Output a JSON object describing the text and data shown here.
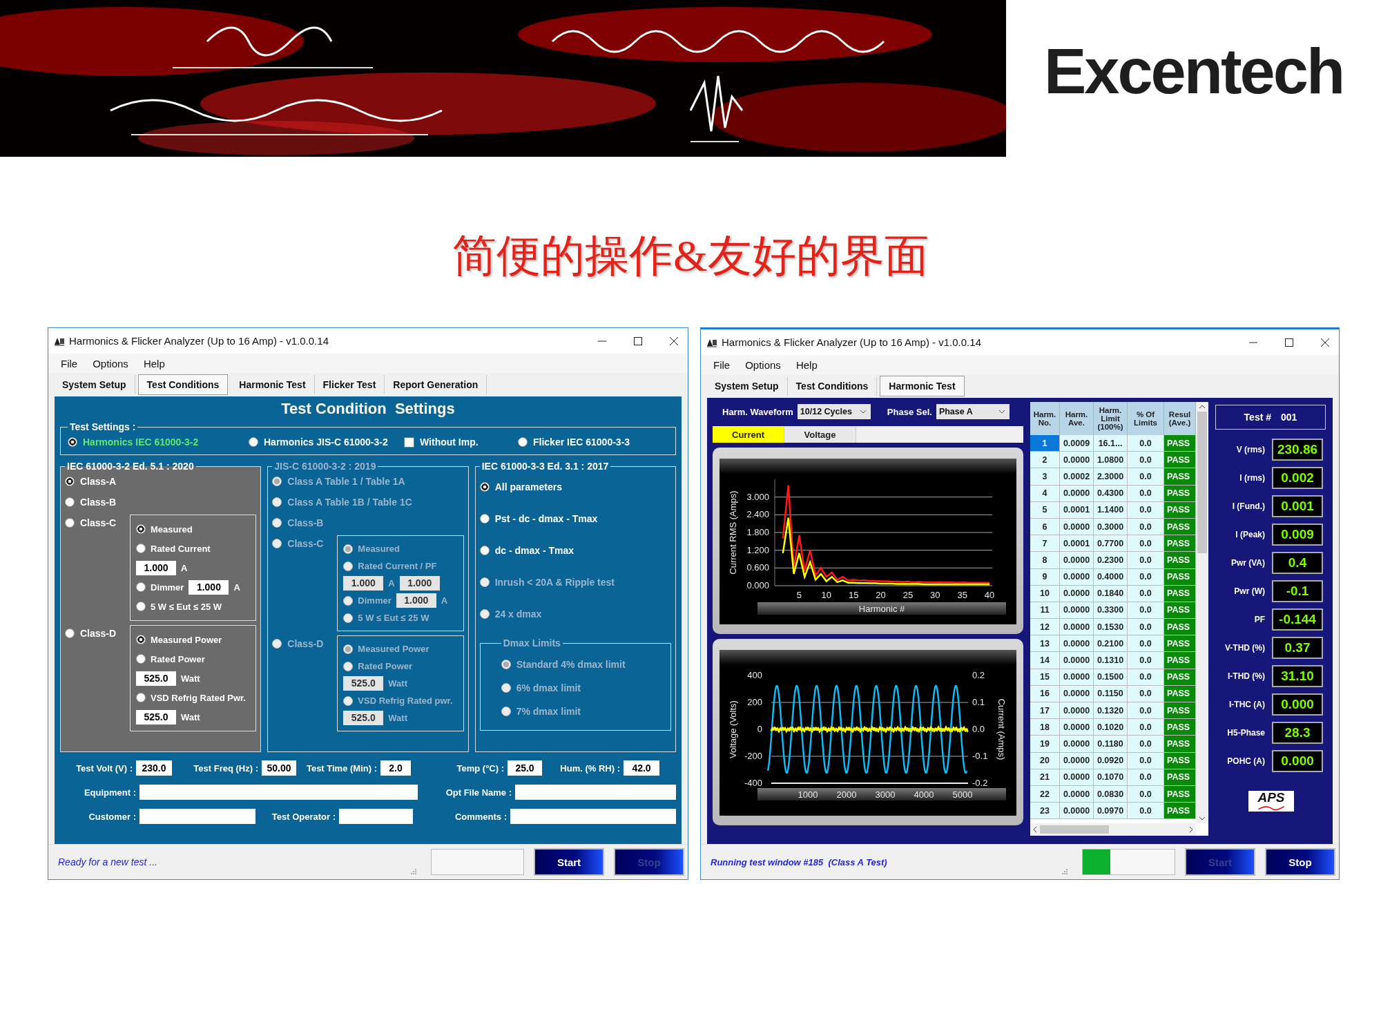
{
  "logo": {
    "text": "Excentech"
  },
  "title": "简便的操作&友好的界面",
  "windows": [
    {
      "kind": "conditions",
      "title": "Harmonics & Flicker Analyzer (Up to 16 Amp) - v1.0.0.14",
      "menu": [
        "File",
        "Options",
        "Help"
      ],
      "tabs": [
        {
          "label": "System Setup",
          "selected": false
        },
        {
          "label": "Test Conditions",
          "selected": true
        },
        {
          "label": "Harmonic Test",
          "selected": false
        },
        {
          "label": "Flicker Test",
          "selected": false
        },
        {
          "label": "Report Generation",
          "selected": false
        }
      ],
      "heading": "Test Condition  Settings",
      "test_settings": {
        "legend": "Test Settings :",
        "options": [
          {
            "kind": "radio",
            "label": "Harmonics IEC 61000-3-2",
            "selected": true
          },
          {
            "kind": "radio",
            "label": "Harmonics JIS-C 61000-3-2",
            "selected": false
          },
          {
            "kind": "checkbox",
            "label": "Without Imp.",
            "checked": false
          },
          {
            "kind": "radio",
            "label": "Flicker IEC 61000-3-3",
            "selected": false
          }
        ]
      },
      "groups": [
        {
          "legend": "IEC 61000-3-2 Ed. 5.1 : 2020",
          "highlighted": true,
          "disabled": false,
          "items": [
            {
              "kind": "radio",
              "label": "Class-A",
              "selected": true
            },
            {
              "kind": "radio",
              "label": "Class-B",
              "selected": false
            },
            {
              "kind": "radio",
              "label": "Class-C",
              "selected": false,
              "options": [
                {
                  "kind": "radio",
                  "label": "Measured",
                  "selected": true
                },
                {
                  "kind": "radio",
                  "label": "Rated Current",
                  "selected": false
                },
                {
                  "kind": "input",
                  "value": "1.000",
                  "unit": "A"
                },
                {
                  "kind": "radio_input",
                  "label": "Dimmer",
                  "selected": false,
                  "value": "1.000",
                  "unit": "A"
                },
                {
                  "kind": "radio",
                  "label": "5 W ≤ Eut ≤ 25 W",
                  "selected": false
                }
              ]
            },
            {
              "kind": "radio",
              "label": "Class-D",
              "selected": false,
              "options": [
                {
                  "kind": "radio",
                  "label": "Measured Power",
                  "selected": true
                },
                {
                  "kind": "radio",
                  "label": "Rated Power",
                  "selected": false
                },
                {
                  "kind": "input",
                  "value": "525.0",
                  "unit": "Watt"
                },
                {
                  "kind": "radio",
                  "label": "VSD Refrig Rated Pwr.",
                  "selected": false
                },
                {
                  "kind": "input",
                  "value": "525.0",
                  "unit": "Watt"
                }
              ]
            }
          ]
        },
        {
          "legend": "JIS-C 61000-3-2 : 2019",
          "highlighted": false,
          "disabled": true,
          "items": [
            {
              "kind": "radio",
              "label": "Class A Table 1 / Table 1A",
              "selected": true
            },
            {
              "kind": "radio",
              "label": "Class A Table 1B / Table 1C",
              "selected": false
            },
            {
              "kind": "radio",
              "label": "Class-B",
              "selected": false
            },
            {
              "kind": "radio",
              "label": "Class-C",
              "selected": false,
              "options": [
                {
                  "kind": "radio",
                  "label": "Measured",
                  "selected": true
                },
                {
                  "kind": "radio",
                  "label": "Rated Current / PF",
                  "selected": false
                },
                {
                  "kind": "input_pair",
                  "values": [
                    "1.000",
                    "1.000"
                  ],
                  "unit": "A"
                },
                {
                  "kind": "radio_input",
                  "label": "Dimmer",
                  "selected": false,
                  "value": "1.000",
                  "unit": "A"
                },
                {
                  "kind": "radio",
                  "label": "5 W ≤ Eut ≤ 25 W",
                  "selected": false
                }
              ]
            },
            {
              "kind": "radio",
              "label": "Class-D",
              "selected": false,
              "options": [
                {
                  "kind": "radio",
                  "label": "Measured Power",
                  "selected": true
                },
                {
                  "kind": "radio",
                  "label": "Rated Power",
                  "selected": false
                },
                {
                  "kind": "input",
                  "value": "525.0",
                  "unit": "Watt"
                },
                {
                  "kind": "radio",
                  "label": "VSD Refrig Rated pwr.",
                  "selected": false
                },
                {
                  "kind": "input",
                  "value": "525.0",
                  "unit": "Watt"
                }
              ]
            }
          ]
        },
        {
          "legend": "IEC 61000-3-3 Ed. 3.1 : 2017",
          "highlighted": false,
          "disabled": false,
          "items": [
            {
              "kind": "radio",
              "label": "All parameters",
              "selected": true,
              "disabled": false
            },
            {
              "kind": "radio",
              "label": "Pst - dc - dmax - Tmax",
              "selected": false,
              "disabled": false
            },
            {
              "kind": "radio",
              "label": "dc - dmax - Tmax",
              "selected": false,
              "disabled": false
            },
            {
              "kind": "radio",
              "label": "Inrush < 20A & Ripple test",
              "selected": false,
              "disabled": true
            },
            {
              "kind": "radio",
              "label": "24 x dmax",
              "selected": false,
              "disabled": true
            },
            {
              "kind": "fieldset",
              "legend": "Dmax Limits",
              "disabled": true,
              "options": [
                {
                  "kind": "radio",
                  "label": "Standard 4% dmax limit",
                  "selected": true
                },
                {
                  "kind": "radio",
                  "label": "6% dmax limit",
                  "selected": false
                },
                {
                  "kind": "radio",
                  "label": "7% dmax limit",
                  "selected": false
                }
              ]
            }
          ]
        }
      ],
      "field_rows": [
        [
          {
            "label": "Test Volt (V) :",
            "value": "230.0"
          },
          {
            "label": "Test Freq (Hz) :",
            "value": "50.00"
          },
          {
            "label": "Test Time (Min) :",
            "value": "2.0"
          },
          {
            "label": "Temp (°C) :",
            "value": "25.0"
          },
          {
            "label": "Hum. (% RH) :",
            "value": "42.0"
          }
        ],
        [
          {
            "label": "Equipment :"
          },
          {
            "label": "Opt File Name :"
          }
        ],
        [
          {
            "label": "Customer :"
          },
          {
            "label": "Test Operator :"
          },
          {
            "label": "Comments :"
          }
        ]
      ],
      "status": {
        "message": "Ready for a new test ...",
        "buttons": [
          {
            "label": "Start",
            "disabled": false
          },
          {
            "label": "Stop",
            "disabled": true
          }
        ]
      }
    },
    {
      "kind": "harmonic",
      "title": "Harmonics & Flicker Analyzer (Up to 16 Amp) - v1.0.0.14",
      "menu": [
        "File",
        "Options",
        "Help"
      ],
      "tabs": [
        {
          "label": "System Setup",
          "selected": false
        },
        {
          "label": "Test Conditions",
          "selected": false
        },
        {
          "label": "Harmonic Test",
          "selected": true
        }
      ],
      "controls": [
        {
          "label": "Harm. Waveform",
          "value": "10/12 Cycles"
        },
        {
          "label": "Phase Sel.",
          "value": "Phase A"
        }
      ],
      "view_tabs": [
        {
          "label": "Current",
          "selected": true
        },
        {
          "label": "Voltage",
          "selected": false
        }
      ],
      "spectrum": {
        "chart_data": {
          "type": "line",
          "xlabel": "Harmonic #",
          "ylabel": "Current RMS (Amps)",
          "x": [
            2,
            3,
            4,
            5,
            6,
            7,
            8,
            9,
            10,
            11,
            12,
            13,
            14,
            15,
            16,
            17,
            18,
            19,
            20,
            21,
            22,
            23,
            24,
            25,
            26,
            27,
            28,
            29,
            30,
            31,
            32,
            33,
            34,
            35,
            36,
            37,
            38,
            39,
            40
          ],
          "series": [
            {
              "color": "#ff1a1a",
              "values": [
                1.6,
                3.4,
                0.6,
                1.7,
                0.5,
                1.2,
                0.35,
                0.6,
                0.3,
                0.45,
                0.2,
                0.3,
                0.18,
                0.2,
                0.17,
                0.18,
                0.16,
                0.16,
                0.15,
                0.15,
                0.14,
                0.14,
                0.13,
                0.14,
                0.12,
                0.13,
                0.12,
                0.12,
                0.11,
                0.12,
                0.11,
                0.11,
                0.1,
                0.11,
                0.1,
                0.1,
                0.1,
                0.1,
                0.1
              ]
            },
            {
              "color": "#ffff00",
              "values": [
                1.1,
                2.3,
                0.4,
                1.1,
                0.3,
                0.8,
                0.2,
                0.4,
                0.15,
                0.3,
                0.12,
                0.18,
                0.1,
                0.1,
                0.09,
                0.09,
                0.08,
                0.08,
                0.07,
                0.07,
                0.07,
                0.06,
                0.06,
                0.06,
                0.06,
                0.06,
                0.05,
                0.05,
                0.05,
                0.05,
                0.05,
                0.05,
                0.05,
                0.05,
                0.05,
                0.05,
                0.05,
                0.05,
                0.05
              ]
            }
          ],
          "xlim": [
            0.5,
            40.5
          ],
          "ylim": [
            0,
            3.6
          ],
          "grid": true,
          "xticks": [
            5,
            10,
            15,
            20,
            25,
            30,
            35,
            40
          ],
          "yticks": [
            {
              "value": 0,
              "label": "0.000"
            },
            {
              "value": 0.6,
              "label": "0.600"
            },
            {
              "value": 1.2,
              "label": "1.200"
            },
            {
              "value": 1.8,
              "label": "1.800"
            },
            {
              "value": 2.4,
              "label": "2.400"
            },
            {
              "value": 3,
              "label": "3.000"
            }
          ]
        }
      },
      "waveform": {
        "ylabel": "Voltage (Volts)",
        "y2label": "Current (Amps)",
        "yticks": [
          "400",
          "200",
          "0",
          "-200",
          "-400"
        ],
        "y2ticks": [
          "0.2",
          "0.1",
          "0.0",
          "-0.1",
          "-0.2"
        ],
        "xticks": [
          "1000",
          "2000",
          "3000",
          "4000",
          "5000"
        ]
      },
      "table": {
        "columns": [
          "Harm. No.",
          "Harm. Ave.",
          "Harm. Limit (100%)",
          "% Of Limits",
          "Resul (Ave.)"
        ],
        "rows": [
          {
            "selected": true,
            "cells": [
              "1",
              "0.0009",
              "16.1...",
              "0.0",
              "PASS"
            ]
          },
          {
            "selected": false,
            "cells": [
              "2",
              "0.0000",
              "1.0800",
              "0.0",
              "PASS"
            ]
          },
          {
            "selected": false,
            "cells": [
              "3",
              "0.0002",
              "2.3000",
              "0.0",
              "PASS"
            ]
          },
          {
            "selected": false,
            "cells": [
              "4",
              "0.0000",
              "0.4300",
              "0.0",
              "PASS"
            ]
          },
          {
            "selected": false,
            "cells": [
              "5",
              "0.0001",
              "1.1400",
              "0.0",
              "PASS"
            ]
          },
          {
            "selected": false,
            "cells": [
              "6",
              "0.0000",
              "0.3000",
              "0.0",
              "PASS"
            ]
          },
          {
            "selected": false,
            "cells": [
              "7",
              "0.0001",
              "0.7700",
              "0.0",
              "PASS"
            ]
          },
          {
            "selected": false,
            "cells": [
              "8",
              "0.0000",
              "0.2300",
              "0.0",
              "PASS"
            ]
          },
          {
            "selected": false,
            "cells": [
              "9",
              "0.0000",
              "0.4000",
              "0.0",
              "PASS"
            ]
          },
          {
            "selected": false,
            "cells": [
              "10",
              "0.0000",
              "0.1840",
              "0.0",
              "PASS"
            ]
          },
          {
            "selected": false,
            "cells": [
              "11",
              "0.0000",
              "0.3300",
              "0.0",
              "PASS"
            ]
          },
          {
            "selected": false,
            "cells": [
              "12",
              "0.0000",
              "0.1530",
              "0.0",
              "PASS"
            ]
          },
          {
            "selected": false,
            "cells": [
              "13",
              "0.0000",
              "0.2100",
              "0.0",
              "PASS"
            ]
          },
          {
            "selected": false,
            "cells": [
              "14",
              "0.0000",
              "0.1310",
              "0.0",
              "PASS"
            ]
          },
          {
            "selected": false,
            "cells": [
              "15",
              "0.0000",
              "0.1500",
              "0.0",
              "PASS"
            ]
          },
          {
            "selected": false,
            "cells": [
              "16",
              "0.0000",
              "0.1150",
              "0.0",
              "PASS"
            ]
          },
          {
            "selected": false,
            "cells": [
              "17",
              "0.0000",
              "0.1320",
              "0.0",
              "PASS"
            ]
          },
          {
            "selected": false,
            "cells": [
              "18",
              "0.0000",
              "0.1020",
              "0.0",
              "PASS"
            ]
          },
          {
            "selected": false,
            "cells": [
              "19",
              "0.0000",
              "0.1180",
              "0.0",
              "PASS"
            ]
          },
          {
            "selected": false,
            "cells": [
              "20",
              "0.0000",
              "0.0920",
              "0.0",
              "PASS"
            ]
          },
          {
            "selected": false,
            "cells": [
              "21",
              "0.0000",
              "0.1070",
              "0.0",
              "PASS"
            ]
          },
          {
            "selected": false,
            "cells": [
              "22",
              "0.0000",
              "0.0830",
              "0.0",
              "PASS"
            ]
          },
          {
            "selected": false,
            "cells": [
              "23",
              "0.0000",
              "0.0970",
              "0.0",
              "PASS"
            ]
          }
        ]
      },
      "readouts": {
        "test_label": "Test #",
        "test_number": "001",
        "items": [
          {
            "label": "V (rms)",
            "value": "230.86"
          },
          {
            "label": "I (rms)",
            "value": "0.002"
          },
          {
            "label": "I (Fund.)",
            "value": "0.001"
          },
          {
            "label": "I (Peak)",
            "value": "0.009"
          },
          {
            "label": "Pwr (VA)",
            "value": "0.4"
          },
          {
            "label": "Pwr (W)",
            "value": "-0.1"
          },
          {
            "label": "PF",
            "value": "-0.144"
          },
          {
            "label": "V-THD (%)",
            "value": "0.37"
          },
          {
            "label": "I-THD (%)",
            "value": "31.10"
          },
          {
            "label": "I-THC (A)",
            "value": "0.000"
          },
          {
            "label": "H5-Phase",
            "value": "28.3"
          },
          {
            "label": "POHC (A)",
            "value": "0.000"
          }
        ]
      },
      "brand": "APS",
      "status": {
        "message": "Running test window #185  (Class A Test)",
        "level": 0.3,
        "buttons": [
          {
            "label": "Start",
            "disabled": true
          },
          {
            "label": "Stop",
            "disabled": false
          }
        ]
      }
    }
  ]
}
